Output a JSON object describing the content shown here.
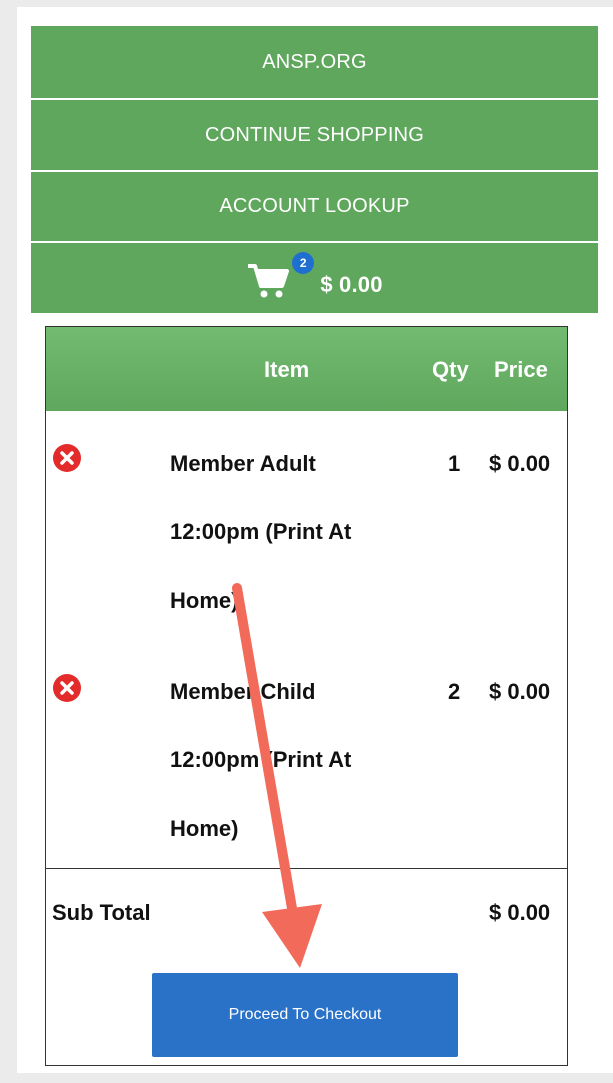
{
  "nav": {
    "items": [
      {
        "label": "ANSP.ORG"
      },
      {
        "label": "CONTINUE SHOPPING"
      },
      {
        "label": "ACCOUNT LOOKUP"
      }
    ],
    "cart": {
      "icon": "shopping-cart-icon",
      "badge_count": "2",
      "total": "$ 0.00"
    }
  },
  "cart_table": {
    "headers": {
      "item": "Item",
      "qty": "Qty",
      "price": "Price"
    },
    "rows": [
      {
        "name_lines": [
          "Member Adult",
          "12:00pm (Print At",
          "Home)"
        ],
        "qty": "1",
        "price": "$ 0.00",
        "remove_icon": "remove-circle-icon"
      },
      {
        "name_lines": [
          "Member Child",
          "12:00pm (Print At",
          "Home)"
        ],
        "qty": "2",
        "price": "$ 0.00",
        "remove_icon": "remove-circle-icon"
      }
    ],
    "subtotal": {
      "label": "Sub Total",
      "value": "$ 0.00"
    },
    "checkout_label": "Proceed To Checkout"
  },
  "colors": {
    "nav_green": "#60a75e",
    "header_green": "#72bb70",
    "checkout_blue": "#2a72c8",
    "badge_blue": "#1f6fd1",
    "remove_red": "#e32b2b",
    "annotation_arrow": "#f26a5a"
  }
}
